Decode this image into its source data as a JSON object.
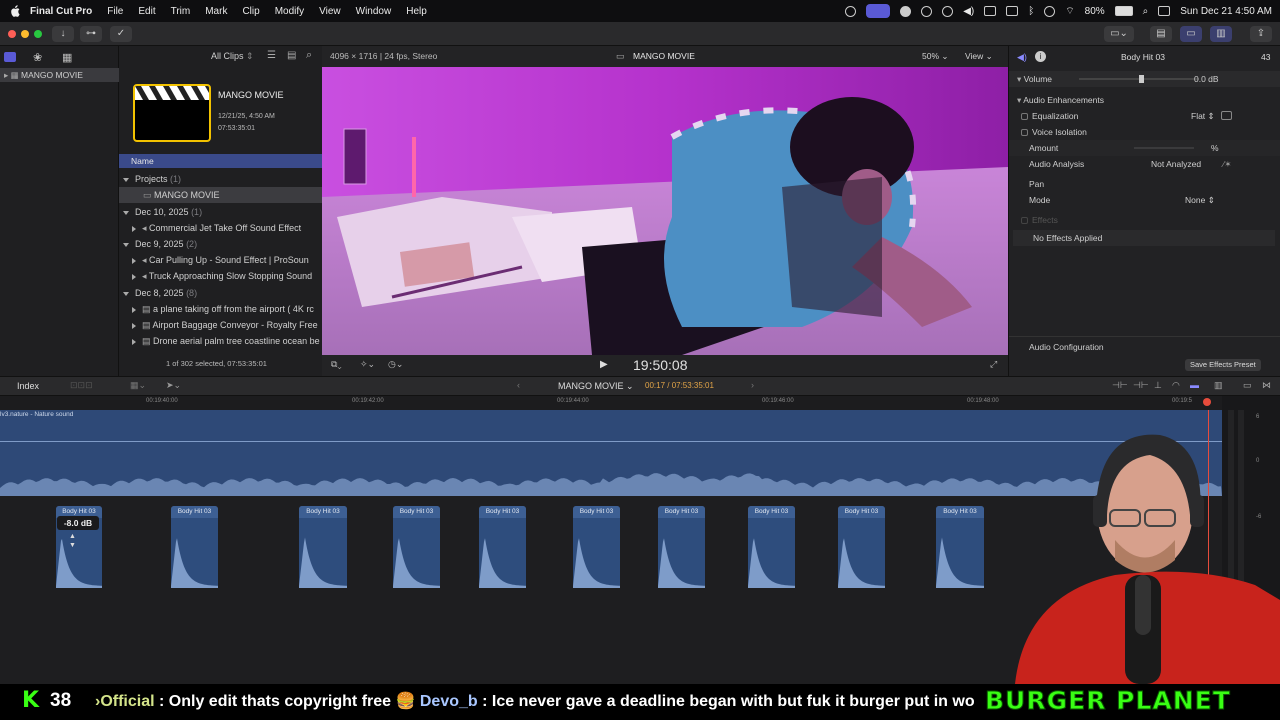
{
  "menubar": {
    "app": "Final Cut Pro",
    "items": [
      "File",
      "Edit",
      "Trim",
      "Mark",
      "Clip",
      "Modify",
      "View",
      "Window",
      "Help"
    ],
    "battery": "80%",
    "datetime": "Sun Dec 21  4:50 AM"
  },
  "library": {
    "name": "MANGO MOVIE"
  },
  "browser": {
    "filter": "All Clips",
    "event_title": "MANGO MOVIE",
    "event_date": "12/21/25, 4:50 AM",
    "event_duration": "07:53:35:01",
    "column_header": "Name",
    "groups": [
      {
        "label": "Projects",
        "count": "(1)",
        "items": [
          "MANGO MOVIE"
        ]
      },
      {
        "label": "Dec 10, 2025",
        "count": "(1)",
        "items": [
          "Commercial Jet Take Off Sound Effect"
        ]
      },
      {
        "label": "Dec 9, 2025",
        "count": "(2)",
        "items": [
          "Car Pulling Up - Sound Effect  |  ProSoun",
          "Truck Approaching Slow Stopping Sound"
        ]
      },
      {
        "label": "Dec 8, 2025",
        "count": "(8)",
        "items": [
          "a plane taking off from the airport ( 4K rc",
          "Airport Baggage Conveyor - Royalty Free",
          "Drone aerial palm tree coastline ocean be"
        ]
      }
    ],
    "status": "1 of 302 selected, 07:53:35:01"
  },
  "viewer": {
    "format": "4096 × 1716 | 24 fps, Stereo",
    "title": "MANGO MOVIE",
    "zoom": "50%",
    "view_label": "View",
    "timecode": "19:50:08"
  },
  "inspector": {
    "clip_name": "Body Hit 03",
    "duration": "43",
    "volume_label": "Volume",
    "volume_value": "0.0 dB",
    "enhancements_label": "Audio Enhancements",
    "equalization_label": "Equalization",
    "equalization_value": "Flat",
    "voice_isolation_label": "Voice Isolation",
    "amount_label": "Amount",
    "amount_value": "%",
    "analysis_label": "Audio Analysis",
    "analysis_value": "Not Analyzed",
    "pan_label": "Pan",
    "mode_label": "Mode",
    "mode_value": "None",
    "effects_label": "Effects",
    "no_effects": "No Effects Applied",
    "audio_config": "Audio Configuration",
    "save_preset": "Save Effects Preset"
  },
  "timeline": {
    "index_label": "Index",
    "project_name": "MANGO MOVIE",
    "position": "00:17 / 07:53:35:01",
    "ruler_ticks": [
      "00:19:40:00",
      "00:19:42:00",
      "00:19:44:00",
      "00:19:46:00",
      "00:19:48:00",
      "00:19:5"
    ],
    "track_label": "lv3.nature - Nature sound",
    "clip_label": "Body Hit 03",
    "clip_gain": "-8.0 dB",
    "clip_count": 10,
    "meter_labels": [
      "6",
      "0",
      "-6"
    ]
  },
  "stream": {
    "k_label": "K",
    "k_count": "38",
    "ticker": [
      {
        "user": "›Official",
        "message": " : Only edit thats copyright free "
      },
      {
        "user": "Devo_b",
        "message": " : Ice never gave a deadline began with but fuk it burger put in work"
      }
    ],
    "brand": "BURGER PLANET"
  },
  "colors": {
    "accent": "#5a5ad6",
    "clip_blue": "#2e4d7d",
    "track_blue": "#2e4977",
    "brand_green": "#39ff14",
    "viewer_magenta": "#b238c9"
  }
}
